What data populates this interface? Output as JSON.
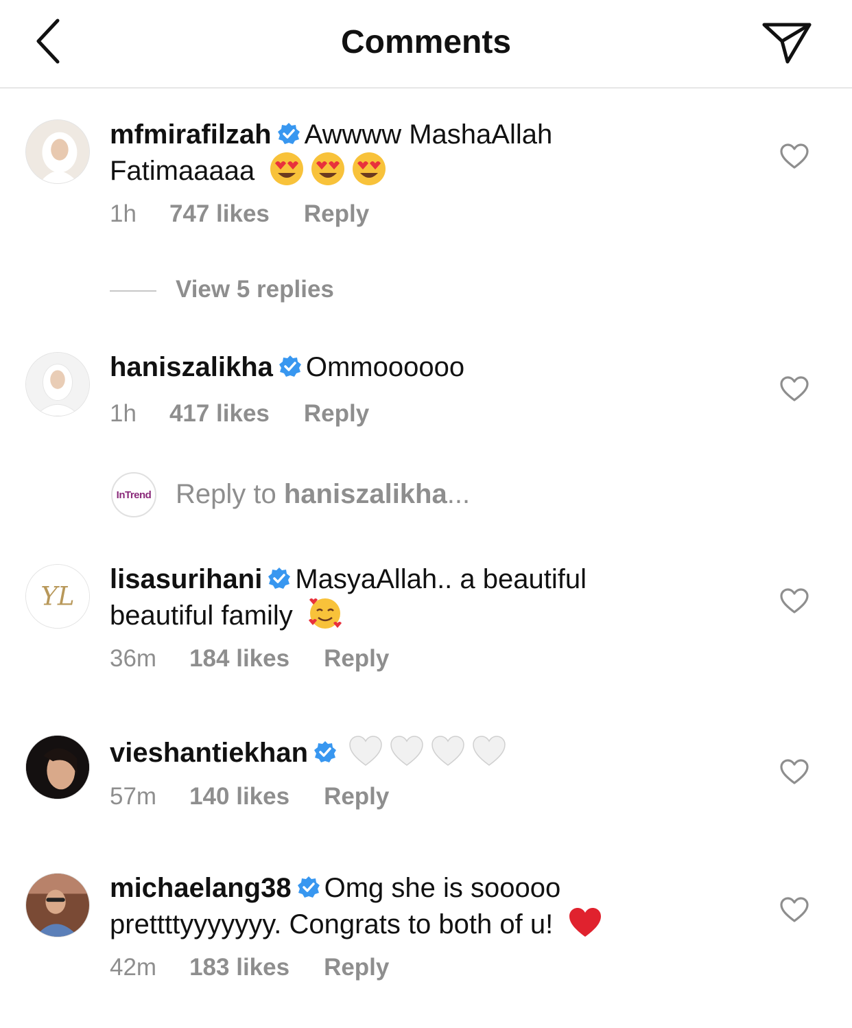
{
  "header": {
    "title": "Comments"
  },
  "comments": [
    {
      "username": "mfmirafilzah",
      "text_line1": "Awwww MashaAllah",
      "text_line2": "Fatimaaaaa",
      "emojis": [
        "heart-eyes",
        "heart-eyes",
        "heart-eyes"
      ],
      "time": "1h",
      "likes": "747 likes",
      "reply": "Reply"
    },
    {
      "username": "haniszalikha",
      "text_line1": "Ommoooooo",
      "time": "1h",
      "likes": "417 likes",
      "reply": "Reply"
    },
    {
      "username": "lisasurihani",
      "text_line1": "MasyaAllah.. a beautiful",
      "text_line2": "beautiful family",
      "emojis": [
        "smiling-face-with-hearts"
      ],
      "time": "36m",
      "likes": "184 likes",
      "reply": "Reply"
    },
    {
      "username": "vieshantiekhan",
      "emojis": [
        "white-heart",
        "white-heart",
        "white-heart",
        "white-heart"
      ],
      "time": "57m",
      "likes": "140 likes",
      "reply": "Reply"
    },
    {
      "username": "michaelang38",
      "text_line1": "Omg she is sooooo",
      "text_line2": "prettttyyyyyyy. Congrats to both of u!",
      "emojis": [
        "red-heart"
      ],
      "time": "42m",
      "likes": "183 likes",
      "reply": "Reply"
    }
  ],
  "view_replies": "View 5 replies",
  "reply_composer": {
    "avatar_text": "InTrend",
    "prefix": "Reply to ",
    "target": "haniszalikha",
    "suffix": "..."
  },
  "colors": {
    "verified": "#3897f0",
    "muted": "#8e8e8e",
    "red_heart": "#e0222e"
  }
}
